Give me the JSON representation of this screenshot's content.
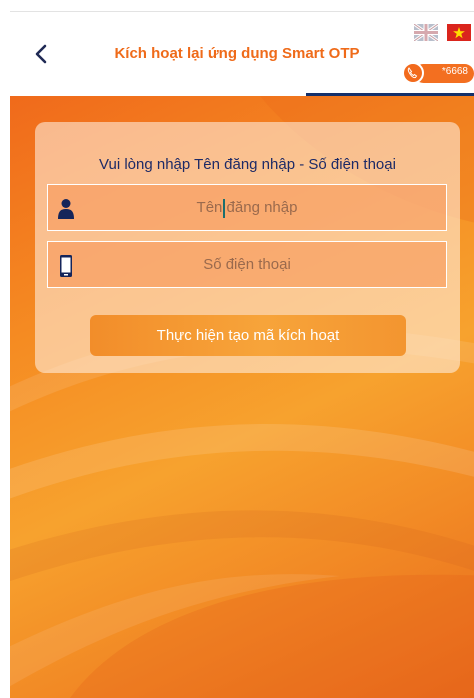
{
  "header": {
    "title": "Kích hoạt lại ứng dụng Smart OTP",
    "back_icon": "chevron-left-icon",
    "language_flags": [
      "flag-uk-icon",
      "flag-vn-icon"
    ],
    "hotline": {
      "number": "*6668",
      "icon": "phone-icon"
    }
  },
  "form": {
    "instruction": "Vui lòng nhập Tên đăng nhập - Số điện thoại",
    "username": {
      "placeholder": "Tên đăng nhập",
      "value": "",
      "icon": "user-icon"
    },
    "phone": {
      "placeholder": "Số điện thoại",
      "value": "",
      "icon": "mobile-phone-icon"
    },
    "submit_label": "Thực hiện tạo mã kích hoạt"
  },
  "colors": {
    "title": "#ef6b1a",
    "accent_navy": "#13306b",
    "background_orange": "#f58b22",
    "instruction_text": "#1d2a66"
  }
}
